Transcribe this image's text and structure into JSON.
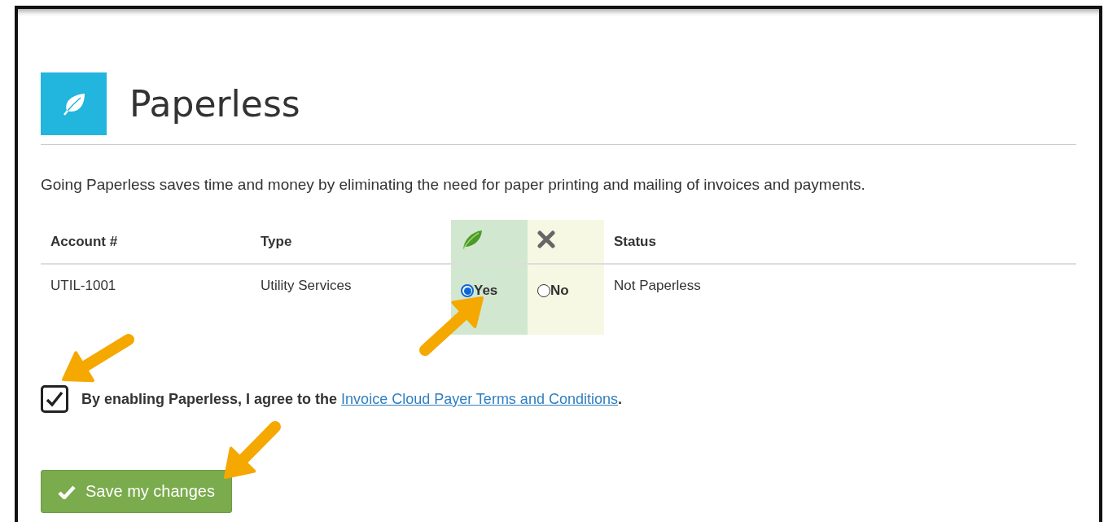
{
  "header": {
    "title": "Paperless"
  },
  "description": "Going Paperless saves time and money by eliminating the need for paper printing and mailing of invoices and payments.",
  "table": {
    "columns": [
      {
        "kind": "text",
        "label": "Account #"
      },
      {
        "kind": "text",
        "label": "Type"
      },
      {
        "kind": "yes"
      },
      {
        "kind": "no"
      },
      {
        "kind": "text",
        "label": "Status"
      }
    ],
    "rows": [
      {
        "account": "UTIL-1001",
        "type": "Utility Services",
        "choices": [
          {
            "label": "Yes",
            "selected": true
          },
          {
            "label": "No",
            "selected": false
          }
        ],
        "status": "Not Paperless"
      }
    ]
  },
  "consent": {
    "checked": true,
    "text": "By enabling Paperless, I agree to the ",
    "link": "Invoice Cloud Payer Terms and Conditions",
    "after": "."
  },
  "save_button": {
    "label": "Save my changes"
  }
}
